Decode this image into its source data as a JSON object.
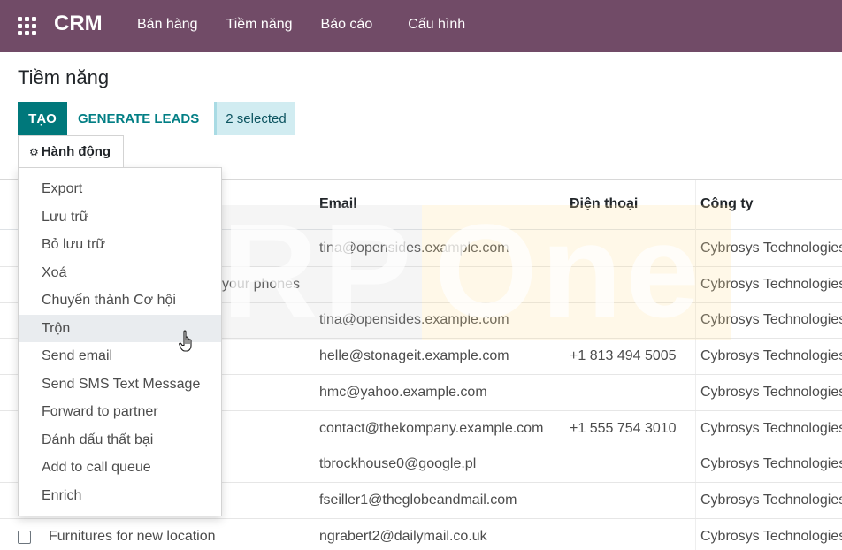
{
  "navbar": {
    "brand": "CRM",
    "menu": [
      "Bán hàng",
      "Tiềm năng",
      "Báo cáo",
      "Cấu hình"
    ]
  },
  "page": {
    "title": "Tiềm năng",
    "create_label": "TẠO",
    "generate_label": "GENERATE LEADS",
    "selected_label": "2 selected",
    "action_label": "Hành động"
  },
  "actions_menu": [
    "Export",
    "Lưu trữ",
    "Bỏ lưu trữ",
    "Xoá",
    "Chuyển thành Cơ hội",
    "Trộn",
    "Send email",
    "Send SMS Text Message",
    "Forward to partner",
    "Đánh dấu thất bại",
    "Add to call queue",
    "Enrich"
  ],
  "table": {
    "headers": {
      "email": "Email",
      "phone": "Điện thoại",
      "company": "Công ty"
    },
    "rows": [
      {
        "name": "",
        "email": "tina@opensides.example.com",
        "phone": "",
        "company": "Cybrosys Technologies"
      },
      {
        "name": "your phones",
        "email": "",
        "phone": "",
        "company": "Cybrosys Technologies"
      },
      {
        "name": "",
        "email": "tina@opensides.example.com",
        "phone": "",
        "company": "Cybrosys Technologies"
      },
      {
        "name": "",
        "email": "helle@stonageit.example.com",
        "phone": "+1 813 494 5005",
        "company": "Cybrosys Technologies"
      },
      {
        "name": "",
        "email": "hmc@yahoo.example.com",
        "phone": "",
        "company": "Cybrosys Technologies"
      },
      {
        "name": "",
        "email": "contact@thekompany.example.com",
        "phone": "+1 555 754 3010",
        "company": "Cybrosys Technologies"
      },
      {
        "name": "",
        "email": "tbrockhouse0@google.pl",
        "phone": "",
        "company": "Cybrosys Technologies"
      },
      {
        "name": "",
        "email": "fseiller1@theglobeandmail.com",
        "phone": "",
        "company": "Cybrosys Technologies"
      },
      {
        "name": "Furnitures for new location",
        "email": "ngrabert2@dailymail.co.uk",
        "phone": "",
        "company": "Cybrosys Technologies"
      }
    ]
  },
  "watermark": {
    "left": "ERP",
    "right": "One"
  },
  "colors": {
    "navbar": "#714b67",
    "primary": "#00787b",
    "badge_bg": "#d1ecf1"
  },
  "icons": {
    "apps": "apps-grid-icon",
    "gear": "gear-icon",
    "cursor": "hand-cursor-icon"
  }
}
